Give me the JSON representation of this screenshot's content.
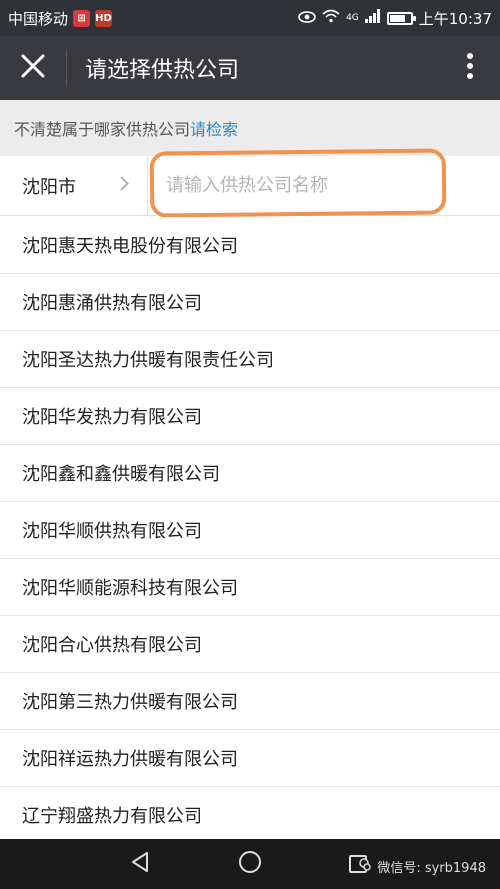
{
  "status_bar": {
    "carrier": "中国移动",
    "badge1": "⊞",
    "badge2": "HD",
    "net": "4G",
    "time": "上午10:37",
    "battery_level": 0.75
  },
  "header": {
    "title": "请选择供热公司",
    "close_icon": "close-icon",
    "more_icon": "more-vertical-icon"
  },
  "hint": {
    "text": "不清楚属于哪家供热公司",
    "link": "请检索"
  },
  "search": {
    "city": "沈阳市",
    "value": "",
    "placeholder": "请输入供热公司名称"
  },
  "companies": [
    "沈阳惠天热电股份有限公司",
    "沈阳惠涌供热有限公司",
    "沈阳圣达热力供暖有限责任公司",
    "沈阳华发热力有限公司",
    "沈阳鑫和鑫供暖有限公司",
    "沈阳华顺供热有限公司",
    "沈阳华顺能源科技有限公司",
    "沈阳合心供热有限公司",
    "沈阳第三热力供暖有限公司",
    "沈阳祥运热力供暖有限公司",
    "辽宁翔盛热力有限公司"
  ],
  "nav_bar": {
    "icons": [
      "back-icon",
      "home-icon",
      "recents-icon"
    ],
    "watermark": "微信号: syrb1948"
  },
  "colors": {
    "status_bg": "#2f3337",
    "title_bg": "#393a3f",
    "link": "#2d88c6",
    "annotation": "#f0934f"
  }
}
